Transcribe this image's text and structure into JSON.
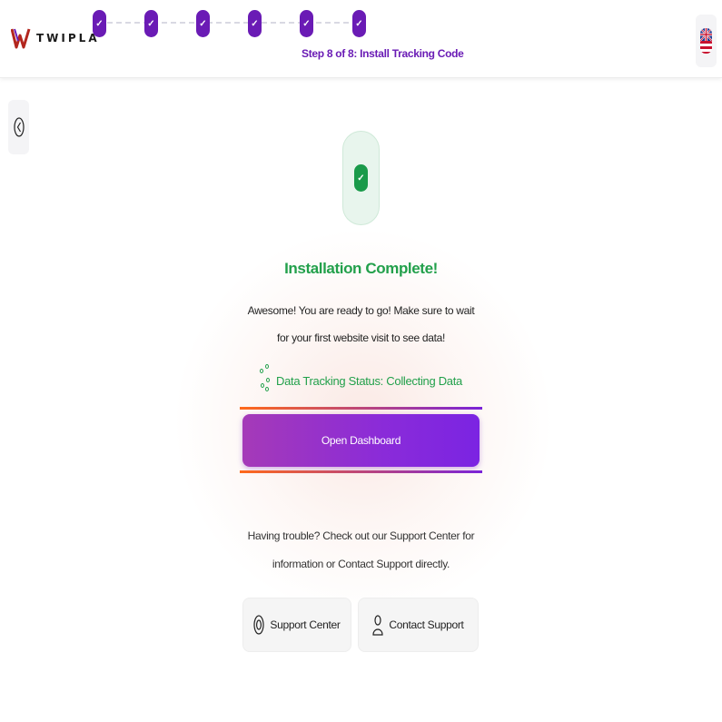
{
  "header": {
    "logo_text": "TWIPLA",
    "step_caption": "Step 8 of 8: Install Tracking Code",
    "steps": [
      "✓",
      "✓",
      "✓",
      "✓",
      "✓",
      "✓"
    ],
    "language_icon": "uk-us-flag-icon"
  },
  "main": {
    "success_icon": "check-icon",
    "title": "Installation Complete!",
    "description": "Awesome! You are ready to go! Make sure to wait for your first website visit to see data!",
    "status_text": "Data Tracking Status: Collecting Data",
    "status_icon": "loading-dots-icon",
    "cta_label": "Open Dashboard",
    "help_text": "Having trouble? Check out our Support Center for information or Contact Support directly.",
    "support_center_label": "Support Center",
    "contact_support_label": "Contact Support"
  },
  "colors": {
    "brand_purple": "#6a1bb5",
    "success_green": "#22a04b",
    "cta_gradient_start": "#a53ab8",
    "cta_gradient_end": "#7b24e2",
    "accent_orange": "#ff6a1a"
  }
}
